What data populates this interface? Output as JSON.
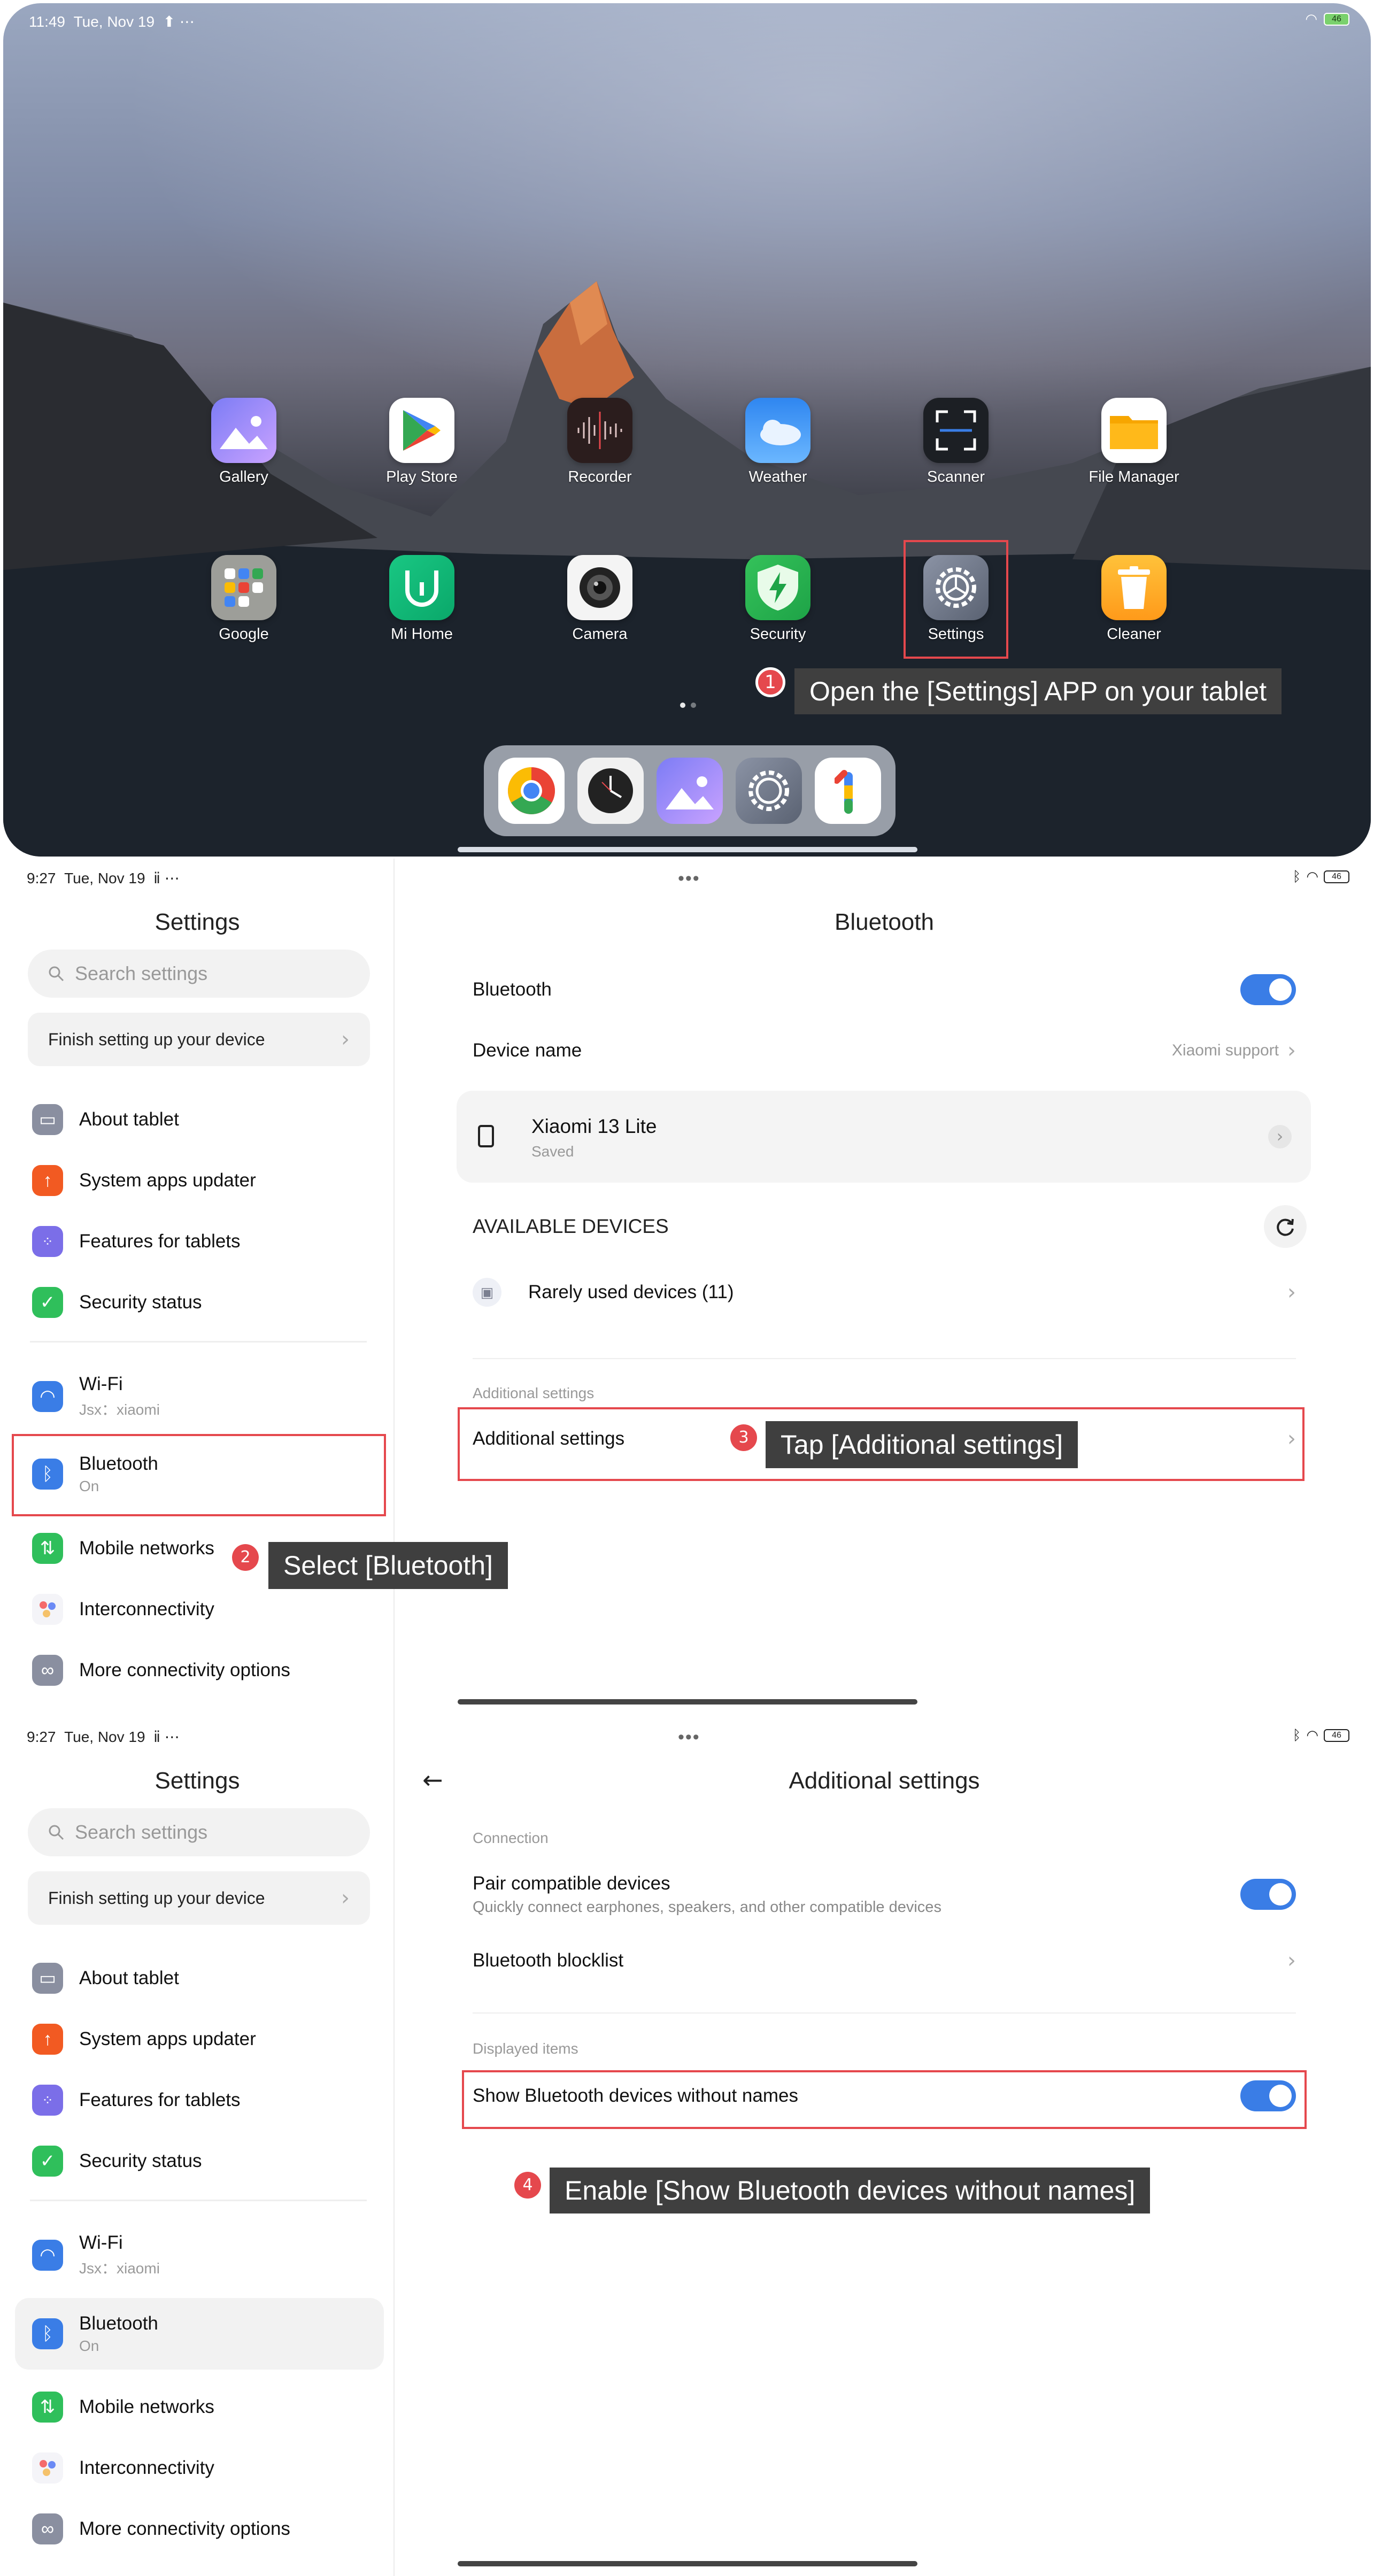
{
  "home": {
    "status": {
      "time": "11:49",
      "date": "Tue, Nov 19",
      "extra": "⬆  ⋯",
      "battery": "46"
    },
    "apps_row1": [
      {
        "label": "Gallery",
        "icon": "gallery-icon"
      },
      {
        "label": "Play Store",
        "icon": "play-store-icon"
      },
      {
        "label": "Recorder",
        "icon": "recorder-icon"
      },
      {
        "label": "Weather",
        "icon": "weather-icon"
      },
      {
        "label": "Scanner",
        "icon": "scanner-icon"
      },
      {
        "label": "File Manager",
        "icon": "file-manager-icon"
      }
    ],
    "apps_row2": [
      {
        "label": "Google",
        "icon": "google-folder-icon"
      },
      {
        "label": "Mi Home",
        "icon": "mi-home-icon"
      },
      {
        "label": "Camera",
        "icon": "camera-icon"
      },
      {
        "label": "Security",
        "icon": "security-icon"
      },
      {
        "label": "Settings",
        "icon": "settings-icon"
      },
      {
        "label": "Cleaner",
        "icon": "cleaner-icon"
      }
    ],
    "dock": [
      "chrome-icon",
      "clock-icon",
      "gallery-icon",
      "settings-icon",
      "google-one-icon"
    ]
  },
  "steps": {
    "s1": {
      "num": "1",
      "text": "Open the [Settings] APP on your tablet"
    },
    "s2": {
      "num": "2",
      "text": "Select [Bluetooth]"
    },
    "s3": {
      "num": "3",
      "text": "Tap [Additional settings]"
    },
    "s4": {
      "num": "4",
      "text": "Enable [Show Bluetooth devices without names]"
    }
  },
  "status_dark": {
    "time": "9:27",
    "date": "Tue, Nov 19",
    "extra": "ⅱ  ⋯",
    "battery": "46"
  },
  "sidebar": {
    "title": "Settings",
    "search_placeholder": "Search settings",
    "finish_setup": "Finish setting up your device",
    "items": [
      {
        "label": "About tablet",
        "icon": "tablet-icon"
      },
      {
        "label": "System apps updater",
        "icon": "update-arrow-icon"
      },
      {
        "label": "Features for tablets",
        "icon": "grid-icon"
      },
      {
        "label": "Security status",
        "icon": "shield-check-icon"
      },
      {
        "label": "Wi-Fi",
        "sub": "Jsx：xiaomi",
        "icon": "wifi-icon"
      },
      {
        "label": "Bluetooth",
        "sub": "On",
        "icon": "bluetooth-icon"
      },
      {
        "label": "Mobile networks",
        "icon": "mobile-data-icon"
      },
      {
        "label": "Interconnectivity",
        "icon": "interconnect-icon"
      },
      {
        "label": "More connectivity options",
        "icon": "link-icon"
      }
    ]
  },
  "bluetooth": {
    "title": "Bluetooth",
    "toggle_label": "Bluetooth",
    "device_name_label": "Device name",
    "device_name_value": "Xiaomi support",
    "paired_name": "Xiaomi 13 Lite",
    "paired_status": "Saved",
    "available_label": "AVAILABLE DEVICES",
    "rarely_used": "Rarely used devices (11)",
    "additional_section": "Additional settings",
    "additional_row": "Additional settings"
  },
  "additional": {
    "title": "Additional settings",
    "connection_section": "Connection",
    "pair_label": "Pair compatible devices",
    "pair_sub": "Quickly connect earphones, speakers, and other compatible devices",
    "blocklist": "Bluetooth blocklist",
    "displayed_section": "Displayed items",
    "show_nameless": "Show Bluetooth devices without names"
  },
  "colors": {
    "accent": "#3a7de6",
    "highlight": "#e5484d",
    "callout_bg": "#3f3f3f"
  }
}
